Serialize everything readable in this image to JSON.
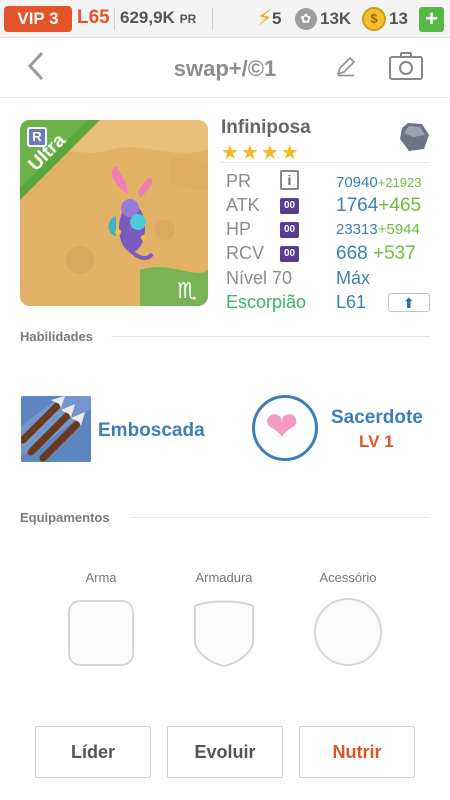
{
  "status_bar": {
    "vip": "VIP 3",
    "level": "L65",
    "power_value": "629,9K",
    "power_unit": "PR",
    "energy": "5",
    "paw_points": "13K",
    "coins": "13",
    "add_label": "+"
  },
  "header": {
    "title": "swap+/©1"
  },
  "monster": {
    "name": "Infiniposa",
    "stars": "★★★★",
    "rarity_badge": "R",
    "rarity": "Ultra",
    "zodiac_symbol": "♏",
    "stats": {
      "pr": {
        "label": "PR",
        "icon": "i",
        "value": "70940",
        "bonus": "+21923"
      },
      "atk": {
        "label": "ATK",
        "icon": "00",
        "value": "1764",
        "bonus": "+465"
      },
      "hp": {
        "label": "HP",
        "icon": "00",
        "value": "23313",
        "bonus": "+5944"
      },
      "rcv": {
        "label": "RCV",
        "icon": "00",
        "value": "668",
        "bonus": "+537"
      }
    },
    "level_label": "Nível 70",
    "level_value": "Máx",
    "sign_label": "Escorpião",
    "sign_value": "L61"
  },
  "sections": {
    "skills": "Habilidades",
    "equipment": "Equipamentos"
  },
  "skills": {
    "active": {
      "name": "Emboscada"
    },
    "leader": {
      "name": "Sacerdote",
      "level": "LV 1"
    }
  },
  "equipment": {
    "weapon": "Arma",
    "armor": "Armadura",
    "accessory": "Acessório"
  },
  "actions": {
    "leader": "Líder",
    "evolve": "Evoluir",
    "feed": "Nutrir"
  },
  "colors": {
    "accent_orange": "#e4532a",
    "accent_blue": "#3d7eb8",
    "accent_green": "#35b56a"
  }
}
